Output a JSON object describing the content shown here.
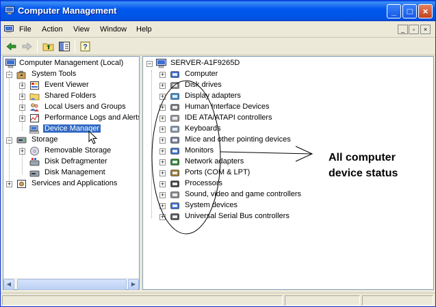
{
  "window": {
    "title": "Computer Management",
    "controls": {
      "minimize": "_",
      "maximize": "□",
      "close": "×"
    }
  },
  "menubar": {
    "items": [
      "File",
      "Action",
      "View",
      "Window",
      "Help"
    ],
    "mdi_controls": [
      "_",
      "▫",
      "×"
    ]
  },
  "toolbar": {
    "buttons": [
      "back-arrow-icon",
      "forward-arrow-icon",
      "up-folder-icon",
      "show-hide-tree-icon",
      "help-icon"
    ]
  },
  "tree": {
    "root": "Computer Management (Local)",
    "system_tools": "System Tools",
    "system_tools_children": [
      "Event Viewer",
      "Shared Folders",
      "Local Users and Groups",
      "Performance Logs and Alerts",
      "Device Manager"
    ],
    "storage": "Storage",
    "storage_children": [
      "Removable Storage",
      "Disk Defragmenter",
      "Disk Management"
    ],
    "services": "Services and Applications",
    "selected": "Device Manager"
  },
  "devices": {
    "server": "SERVER-A1F9265D",
    "categories": [
      "Computer",
      "Disk drives",
      "Display adapters",
      "Human Interface Devices",
      "IDE ATA/ATAPI controllers",
      "Keyboards",
      "Mice and other pointing devices",
      "Monitors",
      "Network adapters",
      "Ports (COM & LPT)",
      "Processors",
      "Sound, video and game controllers",
      "System devices",
      "Universal Serial Bus controllers"
    ]
  },
  "annotation": {
    "line1": "All computer",
    "line2": "device status"
  },
  "colors": {
    "title_bar": "#0054e3",
    "selection": "#316ac5",
    "annotation_ink": "#000000"
  }
}
